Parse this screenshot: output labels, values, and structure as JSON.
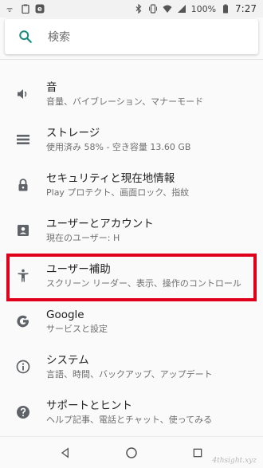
{
  "status_bar": {
    "battery": "100%",
    "time": "7:27"
  },
  "search": {
    "placeholder": "検索"
  },
  "settings": [
    {
      "title": "音",
      "subtitle": "音量、バイブレーション、マナーモード",
      "icon": "volume-icon"
    },
    {
      "title": "ストレージ",
      "subtitle": "使用済み 58% - 空き容量 13.60 GB",
      "icon": "storage-icon"
    },
    {
      "title": "セキュリティと現在地情報",
      "subtitle": "Play プロテクト、画面ロック、指紋",
      "icon": "lock-icon"
    },
    {
      "title": "ユーザーとアカウント",
      "subtitle": "現在のユーザー: H",
      "icon": "account-icon"
    },
    {
      "title": "ユーザー補助",
      "subtitle": "スクリーン リーダー、表示、操作のコントロール",
      "icon": "accessibility-icon"
    },
    {
      "title": "Google",
      "subtitle": "サービスと設定",
      "icon": "google-icon"
    },
    {
      "title": "システム",
      "subtitle": "言語、時間、バックアップ、アップデート",
      "icon": "info-icon"
    },
    {
      "title": "サポートとヒント",
      "subtitle": "ヘルプ記事、電話とチャット、使ってみる",
      "icon": "help-icon"
    }
  ],
  "highlight_color": "#e0001b",
  "watermark": "4thsight.xyz"
}
